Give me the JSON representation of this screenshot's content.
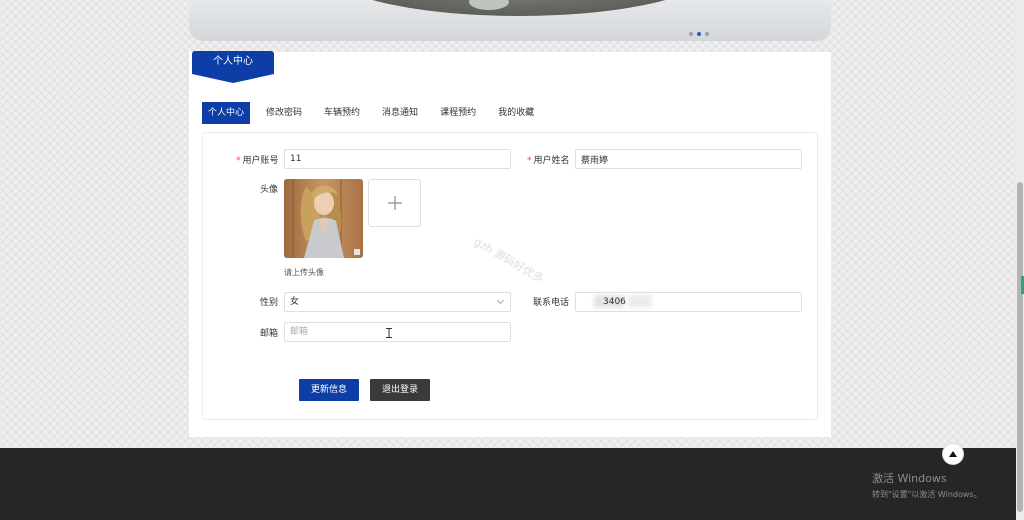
{
  "carousel": {
    "dot_count": 3,
    "active_dot": 1
  },
  "section": {
    "title": "个人中心"
  },
  "tabs": [
    {
      "label": "个人中心",
      "active": true
    },
    {
      "label": "修改密码",
      "active": false
    },
    {
      "label": "车辆预约",
      "active": false
    },
    {
      "label": "消息通知",
      "active": false
    },
    {
      "label": "课程预约",
      "active": false
    },
    {
      "label": "我的收藏",
      "active": false
    }
  ],
  "form": {
    "account": {
      "label": "用户账号",
      "value": "11"
    },
    "name": {
      "label": "用户姓名",
      "value": "蔡雨婷"
    },
    "avatar": {
      "label": "头像",
      "hint": "请上传头像"
    },
    "gender": {
      "label": "性别",
      "value": "女"
    },
    "phone": {
      "label": "联系电话",
      "value": "3406"
    },
    "email": {
      "label": "邮箱",
      "placeholder": "邮箱",
      "value": ""
    },
    "required_mark": "*"
  },
  "actions": {
    "update": "更新信息",
    "logout": "退出登录"
  },
  "watermark": "gzh 源码好优多",
  "os_activation": {
    "line1": "激活 Windows",
    "line2": "转到\"设置\"以激活 Windows。"
  },
  "colors": {
    "primary": "#0d3ea8",
    "footer": "#262626",
    "required": "#e94545"
  }
}
